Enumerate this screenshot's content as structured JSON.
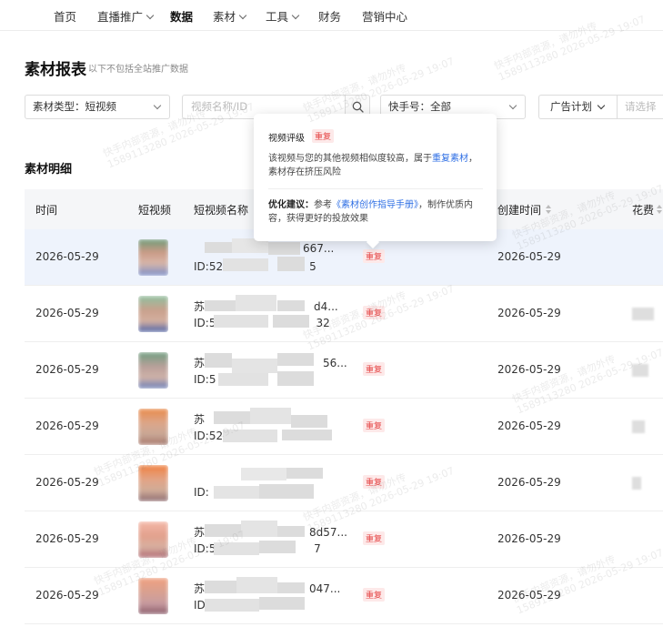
{
  "nav": {
    "items": [
      {
        "label": "首页",
        "active": false,
        "dropdown": false
      },
      {
        "label": "直播推广",
        "active": false,
        "dropdown": true
      },
      {
        "label": "数据",
        "active": true,
        "dropdown": false
      },
      {
        "label": "素材",
        "active": false,
        "dropdown": true
      },
      {
        "label": "工具",
        "active": false,
        "dropdown": true
      },
      {
        "label": "财务",
        "active": false,
        "dropdown": false
      },
      {
        "label": "营销中心",
        "active": false,
        "dropdown": false
      }
    ]
  },
  "page": {
    "title": "素材报表",
    "subtitle": "以下不包括全站推广数据"
  },
  "filters": {
    "material_type_label": "素材类型：",
    "material_type_value": "短视频",
    "search_placeholder": "视频名称/ID",
    "kuaishou_label": "快手号：",
    "kuaishou_value": "全部",
    "ad_plan_label": "广告计划",
    "ad_plan_placeholder": "请选择"
  },
  "section": {
    "title": "素材明细"
  },
  "table": {
    "headers": {
      "time": "时间",
      "video": "短视频",
      "video_name": "短视频名称",
      "created": "创建时间",
      "cost": "花费"
    },
    "rows": [
      {
        "time": "2026-05-29",
        "name1": "",
        "name1_tail": "667...",
        "name2": "ID:52",
        "name2_tail": "5",
        "tag": "重复",
        "created": "2026-05-29"
      },
      {
        "time": "2026-05-29",
        "name1": "苏",
        "name1_tail": "d4...",
        "name2": "ID:5",
        "name2_tail": "32",
        "tag": "重复",
        "created": "2026-05-29"
      },
      {
        "time": "2026-05-29",
        "name1": "苏",
        "name1_tail": "56...",
        "name2": "ID:5",
        "name2_tail": "",
        "tag": "重复",
        "created": "2026-05-29"
      },
      {
        "time": "2026-05-29",
        "name1": "苏",
        "name1_tail": "",
        "name2": "ID:523",
        "name2_tail": "",
        "tag": "重复",
        "created": "2026-05-29"
      },
      {
        "time": "2026-05-29",
        "name1": "",
        "name1_tail": "",
        "name2": "ID:",
        "name2_tail": "",
        "tag": "重复",
        "created": "2026-05-29"
      },
      {
        "time": "2026-05-29",
        "name1": "苏",
        "name1_tail": "8d57...",
        "name2": "ID:52",
        "name2_tail": "7",
        "tag": "重复",
        "created": "2026-05-29"
      },
      {
        "time": "2026-05-29",
        "name1": "苏",
        "name1_tail": "047...",
        "name2": "ID:5",
        "name2_tail": "",
        "tag": "重复",
        "created": "2026-05-29"
      }
    ]
  },
  "tooltip": {
    "title": "视频评级",
    "tag": "重复",
    "desc_pre": "该视频与您的其他视频相似度较高，属于",
    "desc_link": "重复素材",
    "desc_post": "，素材存在挤压风险",
    "advice_label": "优化建议：",
    "advice_pre": "参考",
    "advice_link": "《素材创作指导手册》",
    "advice_post": "，制作优质内容，获得更好的投放效果"
  },
  "watermark": {
    "line1": "快手内部资源，请勿外传",
    "line2": "1589113280 2026-05-29 19:07"
  },
  "colors": {
    "accent_blue": "#2f6fe4",
    "danger_red": "#e54545",
    "hover_row": "#eef3fc",
    "header_bg": "#f5f6f8"
  }
}
